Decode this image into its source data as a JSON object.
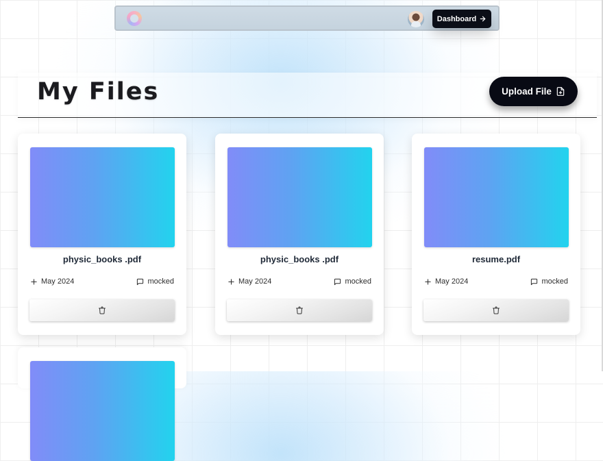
{
  "navbar": {
    "logo_icon": "ring-logo-icon",
    "avatar": "user-avatar",
    "dashboard_label": "Dashboard",
    "dashboard_icon": "arrow-right-icon"
  },
  "header": {
    "title": "My Files",
    "upload_label": "Upload File",
    "upload_icon": "file-plus-icon"
  },
  "files": [
    {
      "name": "physic_books .pdf",
      "date": "May 2024",
      "status": "mocked"
    },
    {
      "name": "physic_books .pdf",
      "date": "May 2024",
      "status": "mocked"
    },
    {
      "name": "resume.pdf",
      "date": "May 2024",
      "status": "mocked"
    }
  ],
  "card_icons": {
    "date_icon": "plus-icon",
    "status_icon": "message-square-icon",
    "delete_icon": "trash-icon"
  },
  "colors": {
    "thumbnail_start": "#818cf8",
    "thumbnail_end": "#22d3ee",
    "button_dark": "#080a14"
  }
}
